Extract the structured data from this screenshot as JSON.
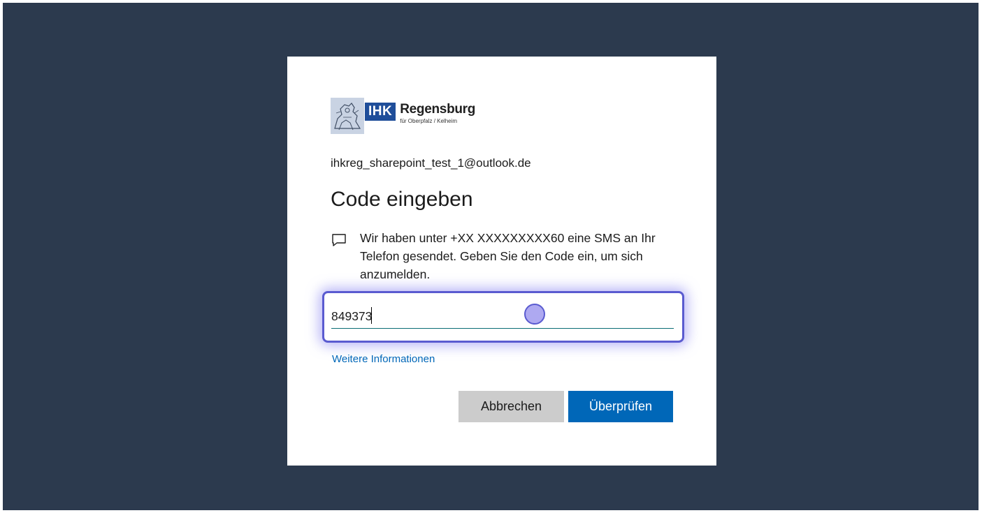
{
  "logo": {
    "badge": "IHK",
    "name": "Regensburg",
    "subtitle": "für Oberpfalz / Kelheim"
  },
  "account": {
    "email": "ihkreg_sharepoint_test_1@outlook.de"
  },
  "page": {
    "heading": "Code eingeben",
    "message": "Wir haben unter +XX XXXXXXXXX60 eine SMS an Ihr Telefon gesendet. Geben Sie den Code ein, um sich anzumelden.",
    "message_icon": "chat-bubble-icon"
  },
  "code_input": {
    "value": "849373"
  },
  "links": {
    "more_info": "Weitere Informationen"
  },
  "buttons": {
    "cancel": "Abbrechen",
    "verify": "Überprüfen"
  },
  "colors": {
    "background": "#2c3a4e",
    "primary": "#0067b8",
    "focus_ring": "#5a5bd0",
    "secondary_button": "#cccccc"
  }
}
